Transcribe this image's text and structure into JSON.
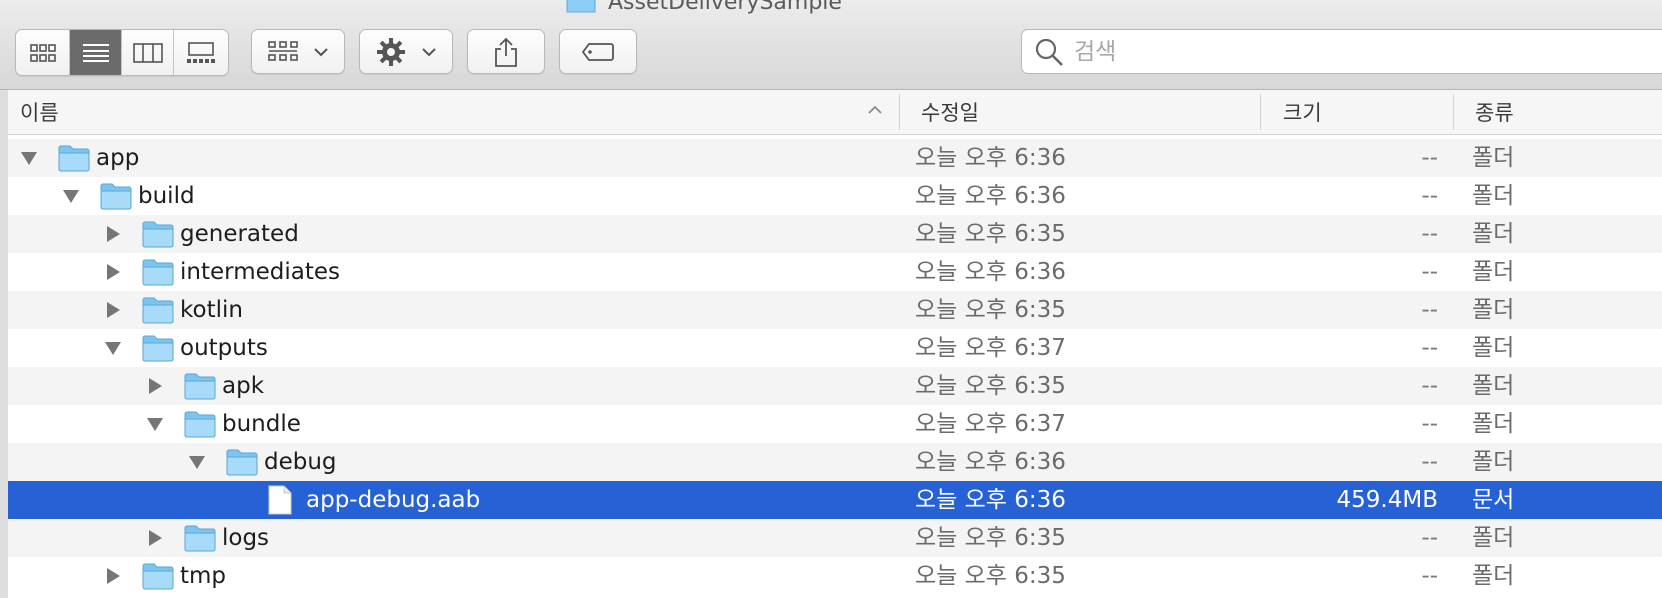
{
  "window": {
    "title": "AssetDeliverySample"
  },
  "toolbar": {
    "view_modes": [
      "icon-view",
      "list-view",
      "column-view",
      "gallery-view"
    ],
    "active_view": "list-view",
    "search_placeholder": "검색"
  },
  "columns": {
    "name": "이름",
    "modified": "수정일",
    "size": "크기",
    "kind": "종류"
  },
  "rows": [
    {
      "name": "app",
      "date": "오늘 오후 6:36",
      "size": "--",
      "kind": "폴더",
      "depth": 0,
      "disclosure": "expanded",
      "type": "folder"
    },
    {
      "name": "build",
      "date": "오늘 오후 6:36",
      "size": "--",
      "kind": "폴더",
      "depth": 1,
      "disclosure": "expanded",
      "type": "folder"
    },
    {
      "name": "generated",
      "date": "오늘 오후 6:35",
      "size": "--",
      "kind": "폴더",
      "depth": 2,
      "disclosure": "collapsed",
      "type": "folder"
    },
    {
      "name": "intermediates",
      "date": "오늘 오후 6:36",
      "size": "--",
      "kind": "폴더",
      "depth": 2,
      "disclosure": "collapsed",
      "type": "folder"
    },
    {
      "name": "kotlin",
      "date": "오늘 오후 6:35",
      "size": "--",
      "kind": "폴더",
      "depth": 2,
      "disclosure": "collapsed",
      "type": "folder"
    },
    {
      "name": "outputs",
      "date": "오늘 오후 6:37",
      "size": "--",
      "kind": "폴더",
      "depth": 2,
      "disclosure": "expanded",
      "type": "folder"
    },
    {
      "name": "apk",
      "date": "오늘 오후 6:35",
      "size": "--",
      "kind": "폴더",
      "depth": 3,
      "disclosure": "collapsed",
      "type": "folder"
    },
    {
      "name": "bundle",
      "date": "오늘 오후 6:37",
      "size": "--",
      "kind": "폴더",
      "depth": 3,
      "disclosure": "expanded",
      "type": "folder"
    },
    {
      "name": "debug",
      "date": "오늘 오후 6:36",
      "size": "--",
      "kind": "폴더",
      "depth": 4,
      "disclosure": "expanded",
      "type": "folder"
    },
    {
      "name": "app-debug.aab",
      "date": "오늘 오후 6:36",
      "size": "459.4MB",
      "kind": "문서",
      "depth": 5,
      "disclosure": "none",
      "type": "file",
      "selected": true
    },
    {
      "name": "logs",
      "date": "오늘 오후 6:35",
      "size": "--",
      "kind": "폴더",
      "depth": 3,
      "disclosure": "collapsed",
      "type": "folder"
    },
    {
      "name": "tmp",
      "date": "오늘 오후 6:35",
      "size": "--",
      "kind": "폴더",
      "depth": 2,
      "disclosure": "collapsed",
      "type": "folder"
    }
  ],
  "colors": {
    "selection": "#2761d6",
    "folder": "#7cc5f3",
    "folder_tab": "#a8dbfa"
  }
}
